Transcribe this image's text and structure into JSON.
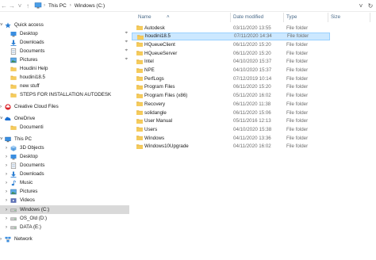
{
  "address": {
    "crumbs": [
      "This PC",
      "Windows (C:)"
    ],
    "separator": "›"
  },
  "sidebar": [
    {
      "label": "Quick access",
      "icon": "star-icon",
      "indent": 0,
      "chevron": "expanded"
    },
    {
      "label": "Desktop",
      "icon": "desktop-icon",
      "indent": 1,
      "pinned": true
    },
    {
      "label": "Downloads",
      "icon": "download-icon",
      "indent": 1,
      "pinned": true
    },
    {
      "label": "Documents",
      "icon": "documents-icon",
      "indent": 1,
      "pinned": true
    },
    {
      "label": "Pictures",
      "icon": "pictures-icon",
      "indent": 1,
      "pinned": true
    },
    {
      "label": "Houdini Help",
      "icon": "folder-icon",
      "indent": 1
    },
    {
      "label": "houdini18.5",
      "icon": "folder-icon",
      "indent": 1
    },
    {
      "label": "new stuff",
      "icon": "folder-icon",
      "indent": 1
    },
    {
      "label": "STEPS FOR INSTALLATION AUTODESK",
      "icon": "folder-icon",
      "indent": 1
    },
    {
      "label": "Creative Cloud Files",
      "icon": "creative-cloud-icon",
      "indent": 0,
      "chevron": "collapsed"
    },
    {
      "label": "OneDrive",
      "icon": "onedrive-icon",
      "indent": 0,
      "chevron": "expanded"
    },
    {
      "label": "Documenti",
      "icon": "folder-icon",
      "indent": 1
    },
    {
      "label": "This PC",
      "icon": "computer-icon",
      "indent": 0,
      "chevron": "expanded"
    },
    {
      "label": "3D Objects",
      "icon": "cube-icon",
      "indent": 1,
      "chevron": "collapsed"
    },
    {
      "label": "Desktop",
      "icon": "desktop-icon",
      "indent": 1,
      "chevron": "collapsed"
    },
    {
      "label": "Documents",
      "icon": "documents-icon",
      "indent": 1,
      "chevron": "collapsed"
    },
    {
      "label": "Downloads",
      "icon": "download-icon",
      "indent": 1,
      "chevron": "collapsed"
    },
    {
      "label": "Music",
      "icon": "music-icon",
      "indent": 1,
      "chevron": "collapsed"
    },
    {
      "label": "Pictures",
      "icon": "pictures-icon",
      "indent": 1,
      "chevron": "collapsed"
    },
    {
      "label": "Videos",
      "icon": "video-icon",
      "indent": 1,
      "chevron": "collapsed"
    },
    {
      "label": "Windows (C:)",
      "icon": "drive-icon",
      "indent": 1,
      "chevron": "collapsed",
      "selected": true
    },
    {
      "label": "OS_Old (D:)",
      "icon": "drive-icon",
      "indent": 1,
      "chevron": "collapsed"
    },
    {
      "label": "DATA (E:)",
      "icon": "drive-icon",
      "indent": 1,
      "chevron": "collapsed"
    },
    {
      "label": "Network",
      "icon": "network-icon",
      "indent": 0,
      "chevron": "collapsed"
    }
  ],
  "columns": {
    "name": "Name",
    "date": "Date modified",
    "type": "Type",
    "size": "Size"
  },
  "files": [
    {
      "name": "Autodesk",
      "date": "03/11/2020 13:55",
      "type": "File folder"
    },
    {
      "name": "houdini18.5",
      "date": "07/11/2020 14:34",
      "type": "File folder",
      "selected": true
    },
    {
      "name": "HQueueClient",
      "date": "06/11/2020 15:20",
      "type": "File folder"
    },
    {
      "name": "HQueueServer",
      "date": "06/11/2020 15:20",
      "type": "File folder"
    },
    {
      "name": "Intel",
      "date": "04/10/2020 15:37",
      "type": "File folder"
    },
    {
      "name": "NPE",
      "date": "04/10/2020 15:37",
      "type": "File folder"
    },
    {
      "name": "PerfLogs",
      "date": "07/12/2019 10:14",
      "type": "File folder"
    },
    {
      "name": "Program Files",
      "date": "06/11/2020 15:20",
      "type": "File folder"
    },
    {
      "name": "Program Files (x86)",
      "date": "05/11/2020 16:02",
      "type": "File folder"
    },
    {
      "name": "Recovery",
      "date": "06/11/2020 11:38",
      "type": "File folder"
    },
    {
      "name": "solidangle",
      "date": "06/11/2020 15:06",
      "type": "File folder"
    },
    {
      "name": "User Manual",
      "date": "05/11/2016 12:13",
      "type": "File folder"
    },
    {
      "name": "Users",
      "date": "04/10/2020 15:38",
      "type": "File folder"
    },
    {
      "name": "Windows",
      "date": "04/11/2020 13:36",
      "type": "File folder"
    },
    {
      "name": "Windows10Upgrade",
      "date": "04/11/2020 16:02",
      "type": "File folder"
    }
  ],
  "colors": {
    "folder": "#e8b84a",
    "selection": "#cce8ff",
    "sidebar_selected": "#d9d9d9",
    "header_text": "#4b6b8a"
  }
}
